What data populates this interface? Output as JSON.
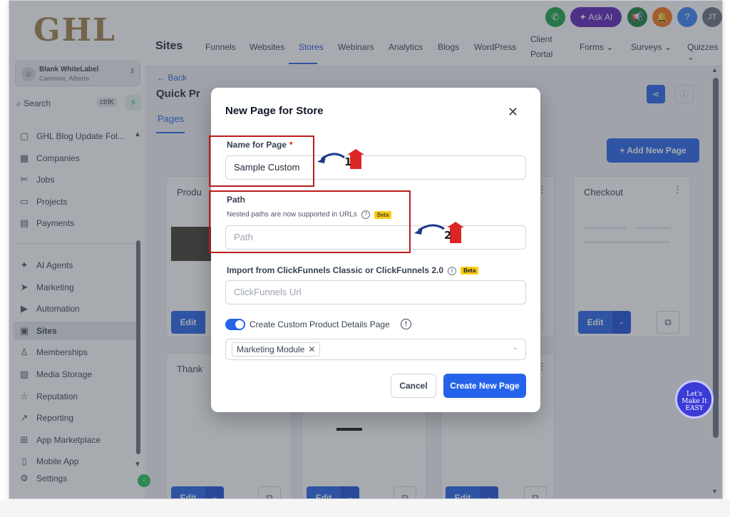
{
  "sidebar": {
    "logo": "GHL",
    "account": {
      "name": "Blank WhiteLabel",
      "location": "Canmore, Alberta"
    },
    "search": {
      "label": "Search",
      "shortcut": "ctrlK"
    },
    "items": [
      {
        "label": "GHL Blog Update Fol...",
        "icon": "cube-icon"
      },
      {
        "label": "Companies",
        "icon": "building-icon"
      },
      {
        "label": "Jobs",
        "icon": "briefcase-icon"
      },
      {
        "label": "Projects",
        "icon": "folder-icon"
      },
      {
        "label": "Payments",
        "icon": "receipt-icon"
      },
      {
        "label": "AI Agents",
        "icon": "sparkle-icon"
      },
      {
        "label": "Marketing",
        "icon": "send-icon"
      },
      {
        "label": "Automation",
        "icon": "play-circle-icon"
      },
      {
        "label": "Sites",
        "icon": "browser-icon"
      },
      {
        "label": "Memberships",
        "icon": "award-icon"
      },
      {
        "label": "Media Storage",
        "icon": "image-icon"
      },
      {
        "label": "Reputation",
        "icon": "star-icon"
      },
      {
        "label": "Reporting",
        "icon": "trend-icon"
      },
      {
        "label": "App Marketplace",
        "icon": "grid-icon"
      },
      {
        "label": "Mobile App",
        "icon": "phone-icon"
      },
      {
        "label": "Settings",
        "icon": "gear-icon"
      }
    ]
  },
  "topbar": {
    "title": "Sites",
    "tabs": [
      "Funnels",
      "Websites",
      "Stores",
      "Webinars",
      "Analytics",
      "Blogs",
      "WordPress",
      "Client",
      "Portal",
      "Forms",
      "Surveys",
      "Quizzes"
    ],
    "ask_ai": "Ask AI",
    "user_initials": "JT",
    "help": "?"
  },
  "content": {
    "back": "← Back",
    "page_title": "Quick Pr",
    "tab_pages": "Pages",
    "add_page": "Add New Page",
    "cards": [
      {
        "title": "Produ"
      },
      {
        "title": "Checkout"
      },
      {
        "title": "Thank"
      }
    ],
    "edit_label": "Edit",
    "badge_text": "Let's Make It EASY"
  },
  "modal": {
    "title": "New Page for Store",
    "name_label": "Name for Page",
    "required_mark": "*",
    "name_value": "Sample Custom",
    "path_label": "Path",
    "path_hint": "Nested paths are now supported in URLs",
    "path_placeholder": "Path",
    "beta": "Beta",
    "import_label": "Import from ClickFunnels Classic or ClickFunnels 2.0",
    "import_placeholder": "ClickFunnels Url",
    "toggle_label": "Create Custom Product Details Page",
    "selected_option": "Marketing Module",
    "cancel": "Cancel",
    "create": "Create New Page"
  },
  "annotations": [
    "1",
    "2"
  ],
  "colors": {
    "primary": "#2563eb",
    "highlight": "#b91c1c",
    "logo": "#a0814e"
  }
}
